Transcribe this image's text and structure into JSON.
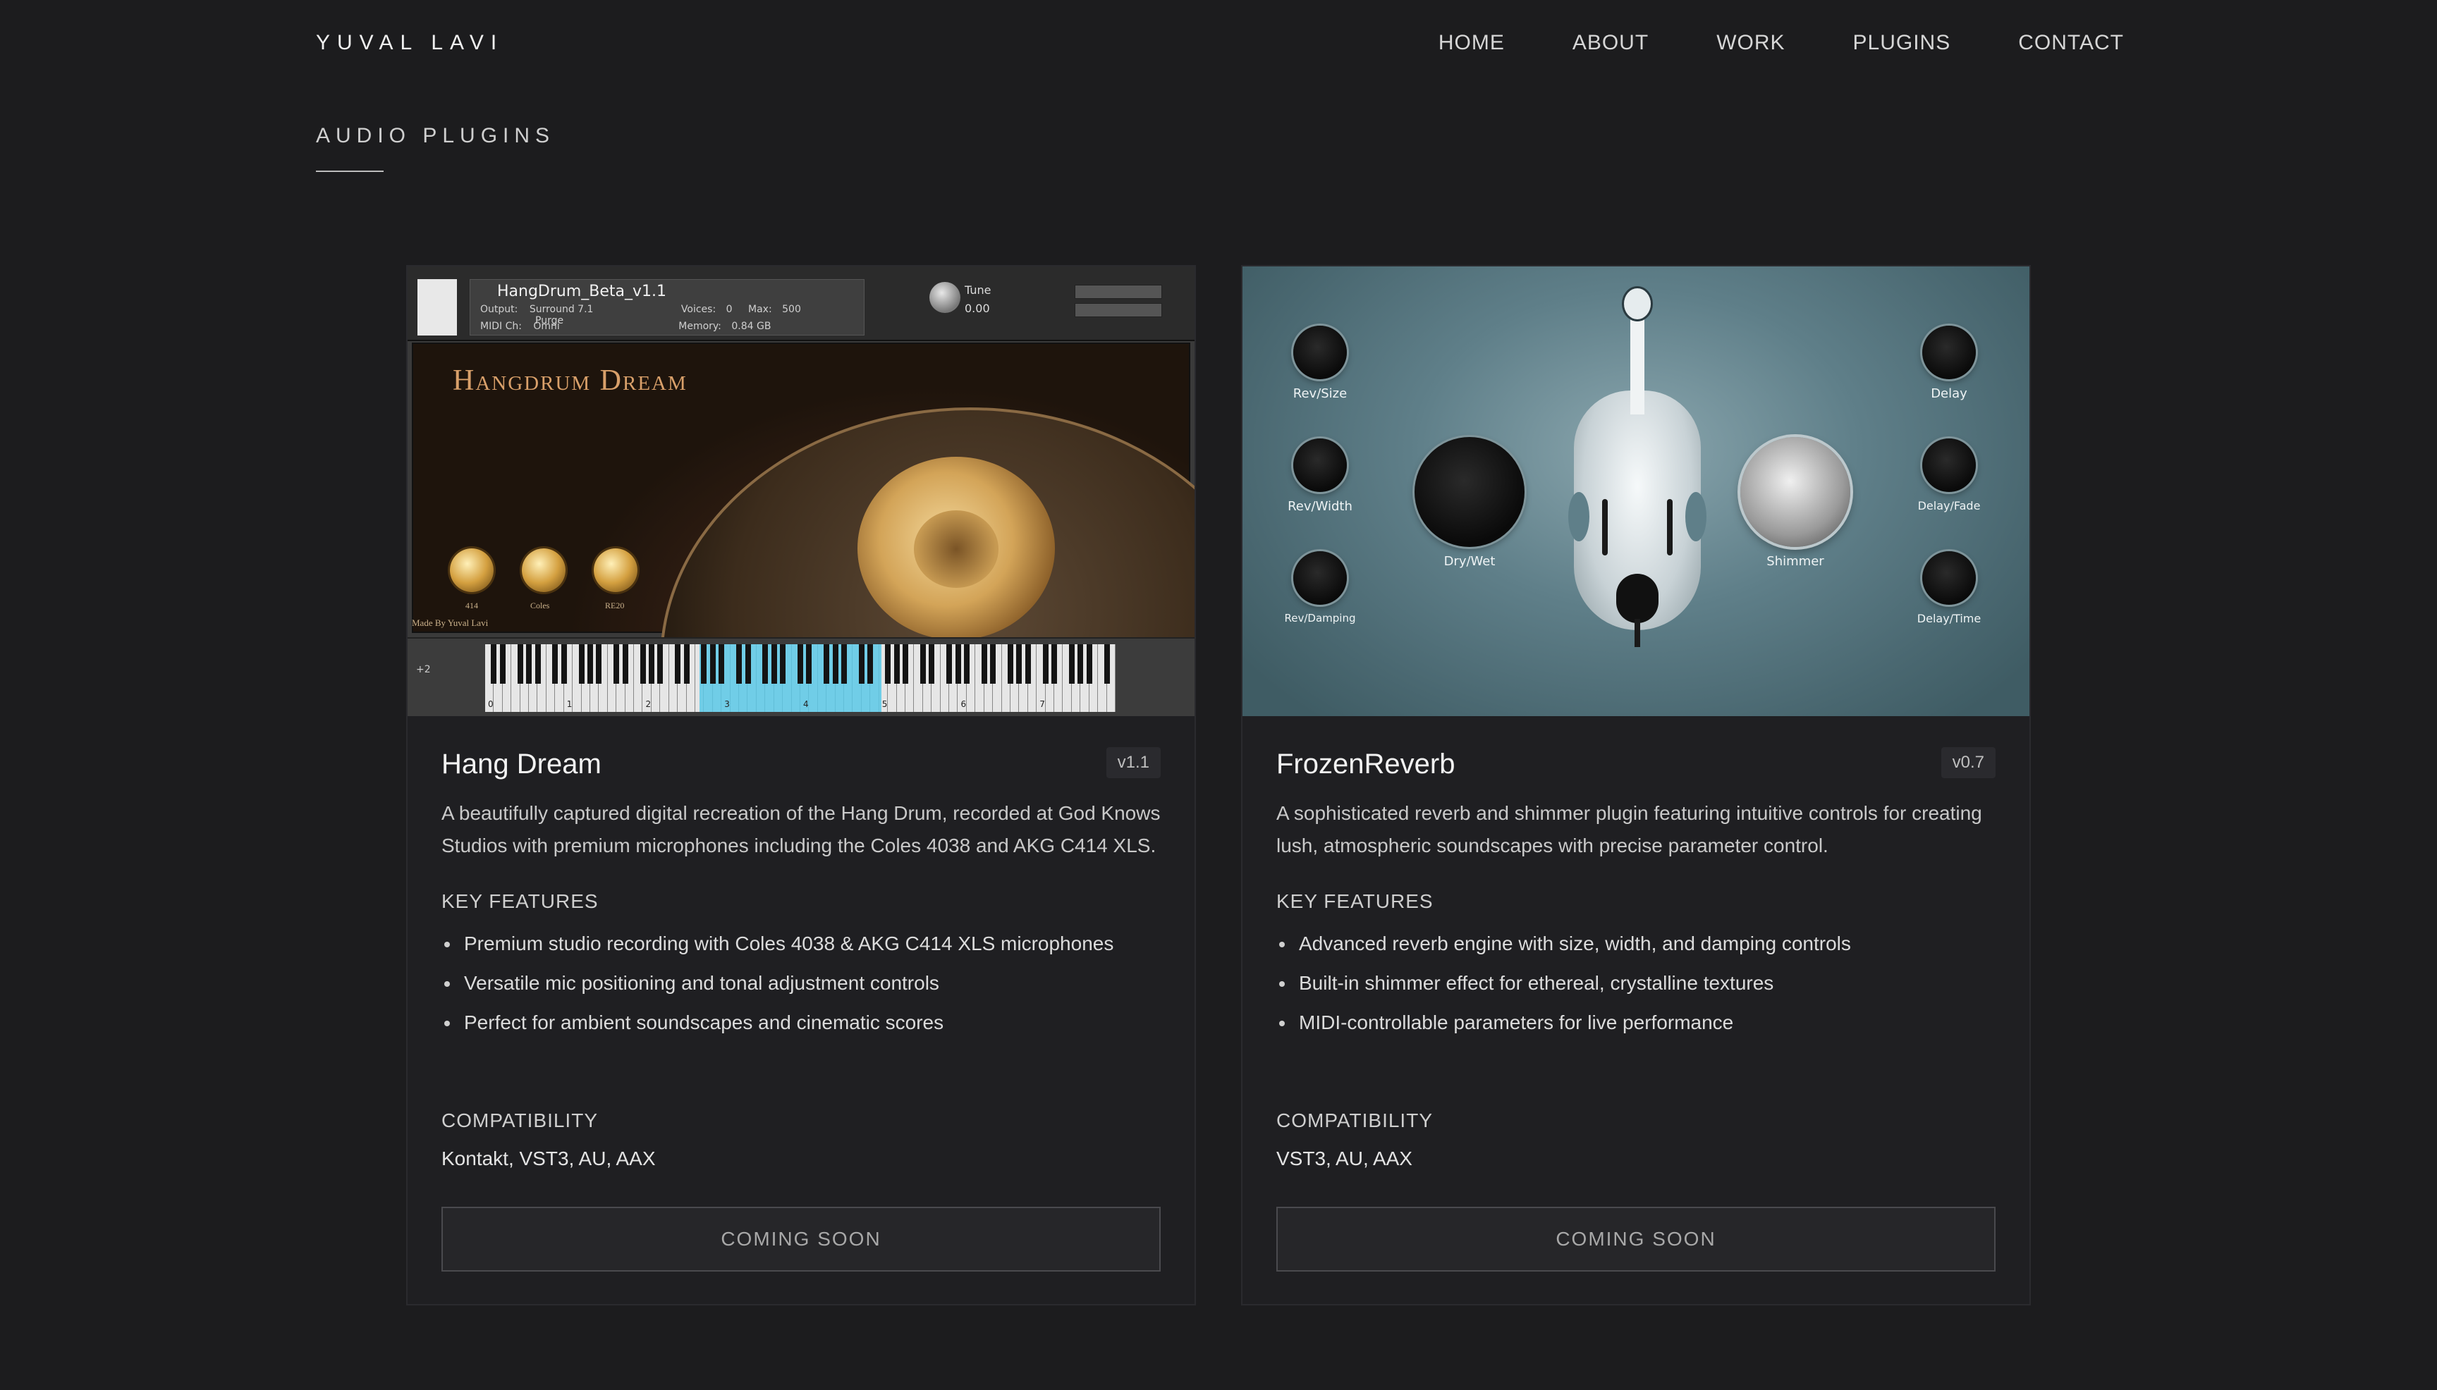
{
  "header": {
    "brand": "YUVAL LAVI",
    "nav": [
      "HOME",
      "ABOUT",
      "WORK",
      "PLUGINS",
      "CONTACT"
    ]
  },
  "section": {
    "title": "AUDIO PLUGINS"
  },
  "plugins": [
    {
      "name": "Hang Dream",
      "version": "v1.1",
      "description": "A beautifully captured digital recreation of the Hang Drum, recorded at God Knows Studios with premium microphones including the Coles 4038 and AKG C414 XLS.",
      "features_title": "KEY FEATURES",
      "features": [
        "Premium studio recording with Coles 4038 & AKG C414 XLS microphones",
        "Versatile mic positioning and tonal adjustment controls",
        "Perfect for ambient soundscapes and cinematic scores"
      ],
      "compat_title": "COMPATIBILITY",
      "compat": "Kontakt, VST3, AU, AAX",
      "cta": "COMING SOON",
      "ui": {
        "instrument": "HangDrum_Beta_v1.1",
        "output_label": "Output:",
        "output": "Surround 7.1",
        "voices_label": "Voices:",
        "voices": "0",
        "max_label": "Max:",
        "max": "500",
        "purge": "Purge",
        "midi_label": "MIDI Ch:",
        "midi": "Omni",
        "memory_label": "Memory:",
        "memory": "0.84 GB",
        "tune_label": "Tune",
        "tune_value": "0.00",
        "stage_title": "Hangdrum Dream",
        "knobs": [
          "414",
          "Coles",
          "RE20"
        ],
        "made_by": "Made By Yuval Lavi",
        "octave_shift": "+2",
        "octaves": [
          "0",
          "1",
          "2",
          "3",
          "4",
          "5",
          "6",
          "7"
        ]
      }
    },
    {
      "name": "FrozenReverb",
      "version": "v0.7",
      "description": "A sophisticated reverb and shimmer plugin featuring intuitive controls for creating lush, atmospheric soundscapes with precise parameter control.",
      "features_title": "KEY FEATURES",
      "features": [
        "Advanced reverb engine with size, width, and damping controls",
        "Built-in shimmer effect for ethereal, crystalline textures",
        "MIDI-controllable parameters for live performance"
      ],
      "compat_title": "COMPATIBILITY",
      "compat": "VST3, AU, AAX",
      "cta": "COMING SOON",
      "ui": {
        "knobs_left": [
          "Rev/Size",
          "Rev/Width",
          "Rev/Damping"
        ],
        "knobs_right": [
          "Delay",
          "Delay/Fade",
          "Delay/Time"
        ],
        "big_left": "Dry/Wet",
        "big_right": "Shimmer"
      }
    }
  ]
}
